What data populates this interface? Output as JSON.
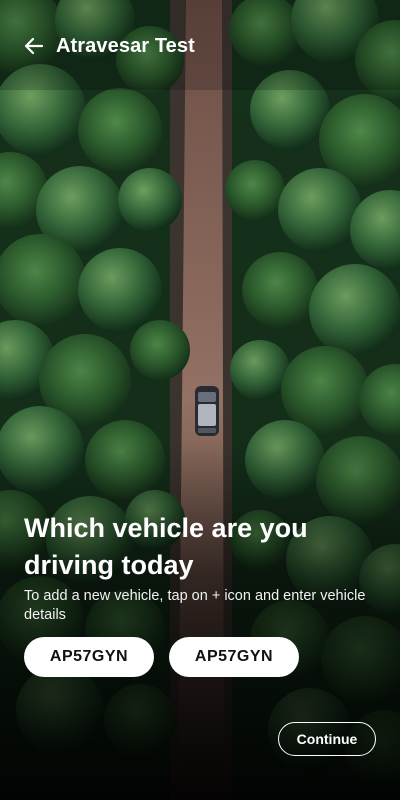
{
  "app_bar": {
    "title": "Atravesar Test",
    "back_icon": "arrow-left-icon"
  },
  "prompt": {
    "heading": "Which vehicle are you driving today",
    "subtitle": "To add a new vehicle, tap on + icon and enter vehicle details"
  },
  "vehicles": [
    {
      "plate": "AP57GYN"
    },
    {
      "plate": "AP57GYN"
    }
  ],
  "actions": {
    "continue_label": "Continue"
  },
  "colors": {
    "forest_green": "#1f3f24",
    "road": "#8a6a5e",
    "chip_background": "#ffffff",
    "text": "#ffffff"
  }
}
